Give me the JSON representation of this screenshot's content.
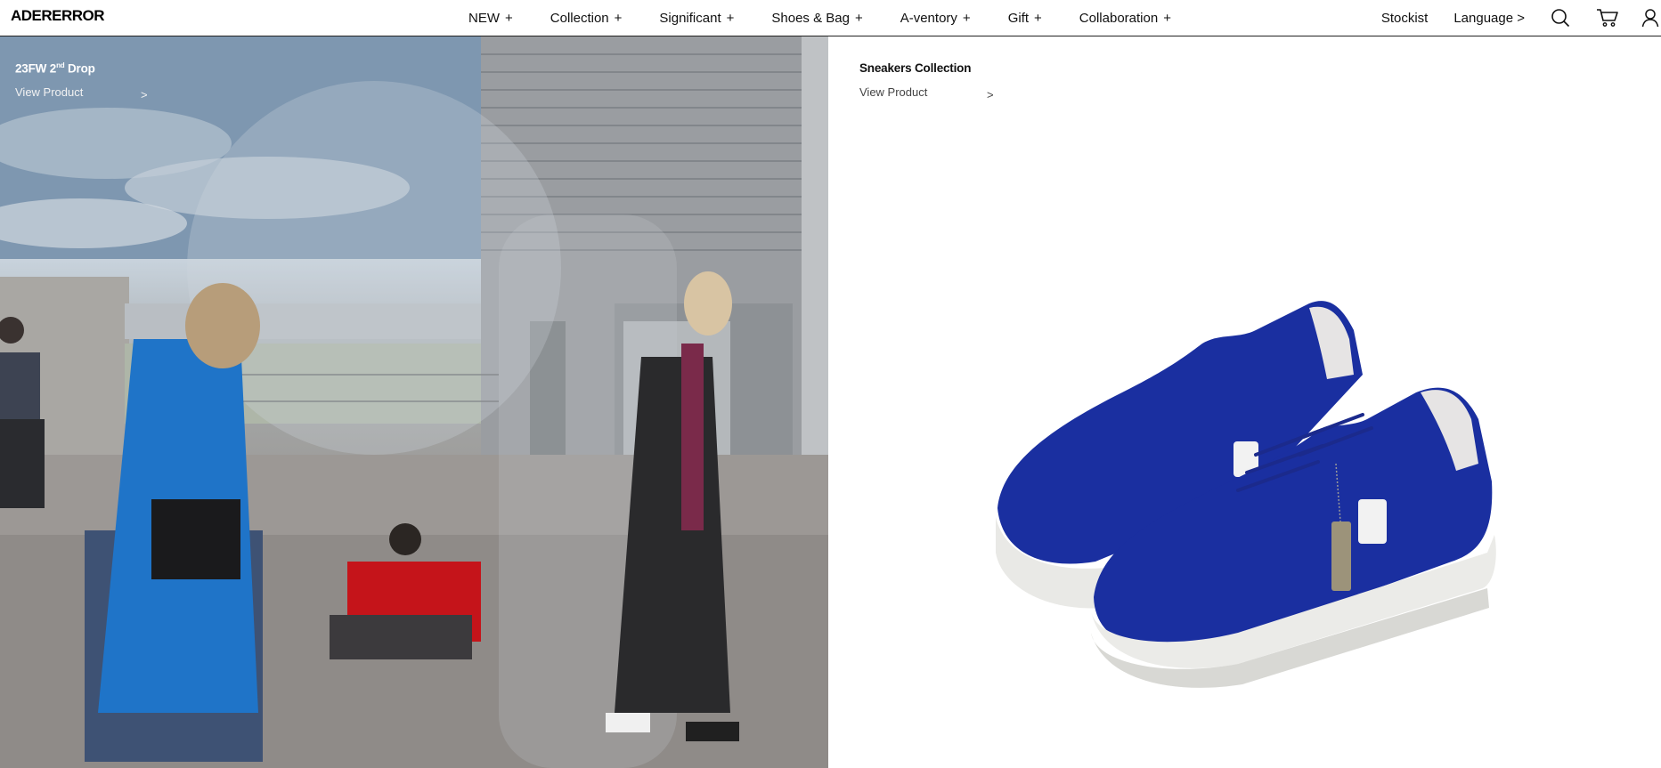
{
  "header": {
    "logo": "ADERERROR",
    "nav": [
      {
        "label": "NEW",
        "plus": "+"
      },
      {
        "label": "Collection",
        "plus": "+"
      },
      {
        "label": "Significant",
        "plus": "+"
      },
      {
        "label": "Shoes & Bag",
        "plus": "+"
      },
      {
        "label": "A-ventory",
        "plus": "+"
      },
      {
        "label": "Gift",
        "plus": "+"
      },
      {
        "label": "Collaboration",
        "plus": "+"
      }
    ],
    "stockist": "Stockist",
    "language": "Language >",
    "icons": [
      "search-icon",
      "cart-icon",
      "account-icon"
    ]
  },
  "left_panel": {
    "title_main": "23FW 2",
    "title_sup": "nd",
    "title_end": " Drop",
    "link": "View Product",
    "arrow": ">"
  },
  "right_panel": {
    "title": "Sneakers Collection",
    "link": "View Product",
    "arrow": ">"
  },
  "colors": {
    "coat_blue": "#1f74c8",
    "sneaker_blue": "#1a2fa0",
    "header_border": "#222222"
  }
}
